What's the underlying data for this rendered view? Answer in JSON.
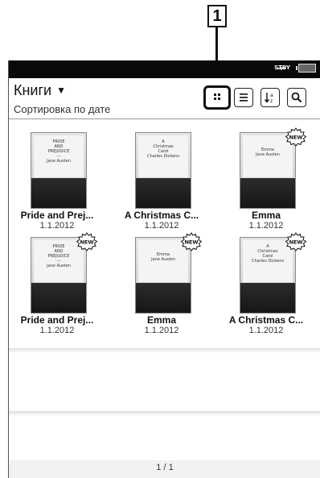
{
  "callout": {
    "number": "1"
  },
  "status_bar": {
    "standby": "STBY",
    "icons": [
      "wifi-icon",
      "battery-icon"
    ]
  },
  "header": {
    "title": "Книги",
    "title_caret": "▼",
    "sort_label": "Сортировка по дате",
    "buttons": [
      "grid-view-button",
      "list-view-button",
      "sort-az-button",
      "search-button"
    ]
  },
  "books": [
    {
      "title": "Pride and Prej...",
      "date": "1.1.2012",
      "cover_lines": [
        "PRIDE",
        "AND",
        "PREJUDICE",
        "— ",
        "Jane Austen"
      ],
      "is_new": false
    },
    {
      "title": "A Christmas C...",
      "date": "1.1.2012",
      "cover_lines": [
        "A",
        "Christmas",
        "Carol",
        "",
        "Charles Dickens"
      ],
      "is_new": false
    },
    {
      "title": "Emma",
      "date": "1.1.2012",
      "cover_lines": [
        "Emma",
        "",
        "Jane Austen"
      ],
      "is_new": true
    },
    {
      "title": "Pride and Prej...",
      "date": "1.1.2012",
      "cover_lines": [
        "PRIDE",
        "AND",
        "PREJUDICE",
        "— ",
        "Jane Austen"
      ],
      "is_new": true
    },
    {
      "title": "Emma",
      "date": "1.1.2012",
      "cover_lines": [
        "Emma",
        "",
        "Jane Austen"
      ],
      "is_new": true
    },
    {
      "title": "A Christmas C...",
      "date": "1.1.2012",
      "cover_lines": [
        "A",
        "Christmas",
        "Carol",
        "",
        "Charles Dickens"
      ],
      "is_new": true
    }
  ],
  "new_badge": "NEW",
  "pagination": {
    "label": "1 / 1"
  }
}
